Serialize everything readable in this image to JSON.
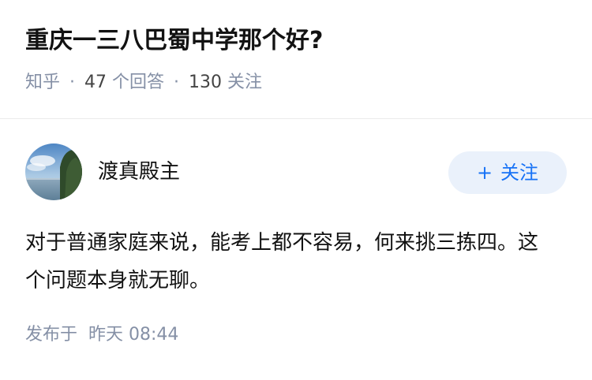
{
  "question": {
    "title": "重庆一三八巴蜀中学那个好?",
    "source": "知乎",
    "answers_count": "47",
    "answers_label": "个回答",
    "follows_count": "130",
    "follows_label": "关注"
  },
  "answer": {
    "author_name": "渡真殿主",
    "follow_plus": "+",
    "follow_label": "关注",
    "content": "对于普通家庭来说，能考上都不容易，何来挑三拣四。这个问题本身就无聊。",
    "published_label": "发布于",
    "published_time": "昨天 08:44"
  },
  "colors": {
    "accent": "#1772f6",
    "follow_bg": "#eaf1fb",
    "meta_gray": "#8590a6"
  },
  "icons": {
    "avatar": "landscape-avatar"
  }
}
